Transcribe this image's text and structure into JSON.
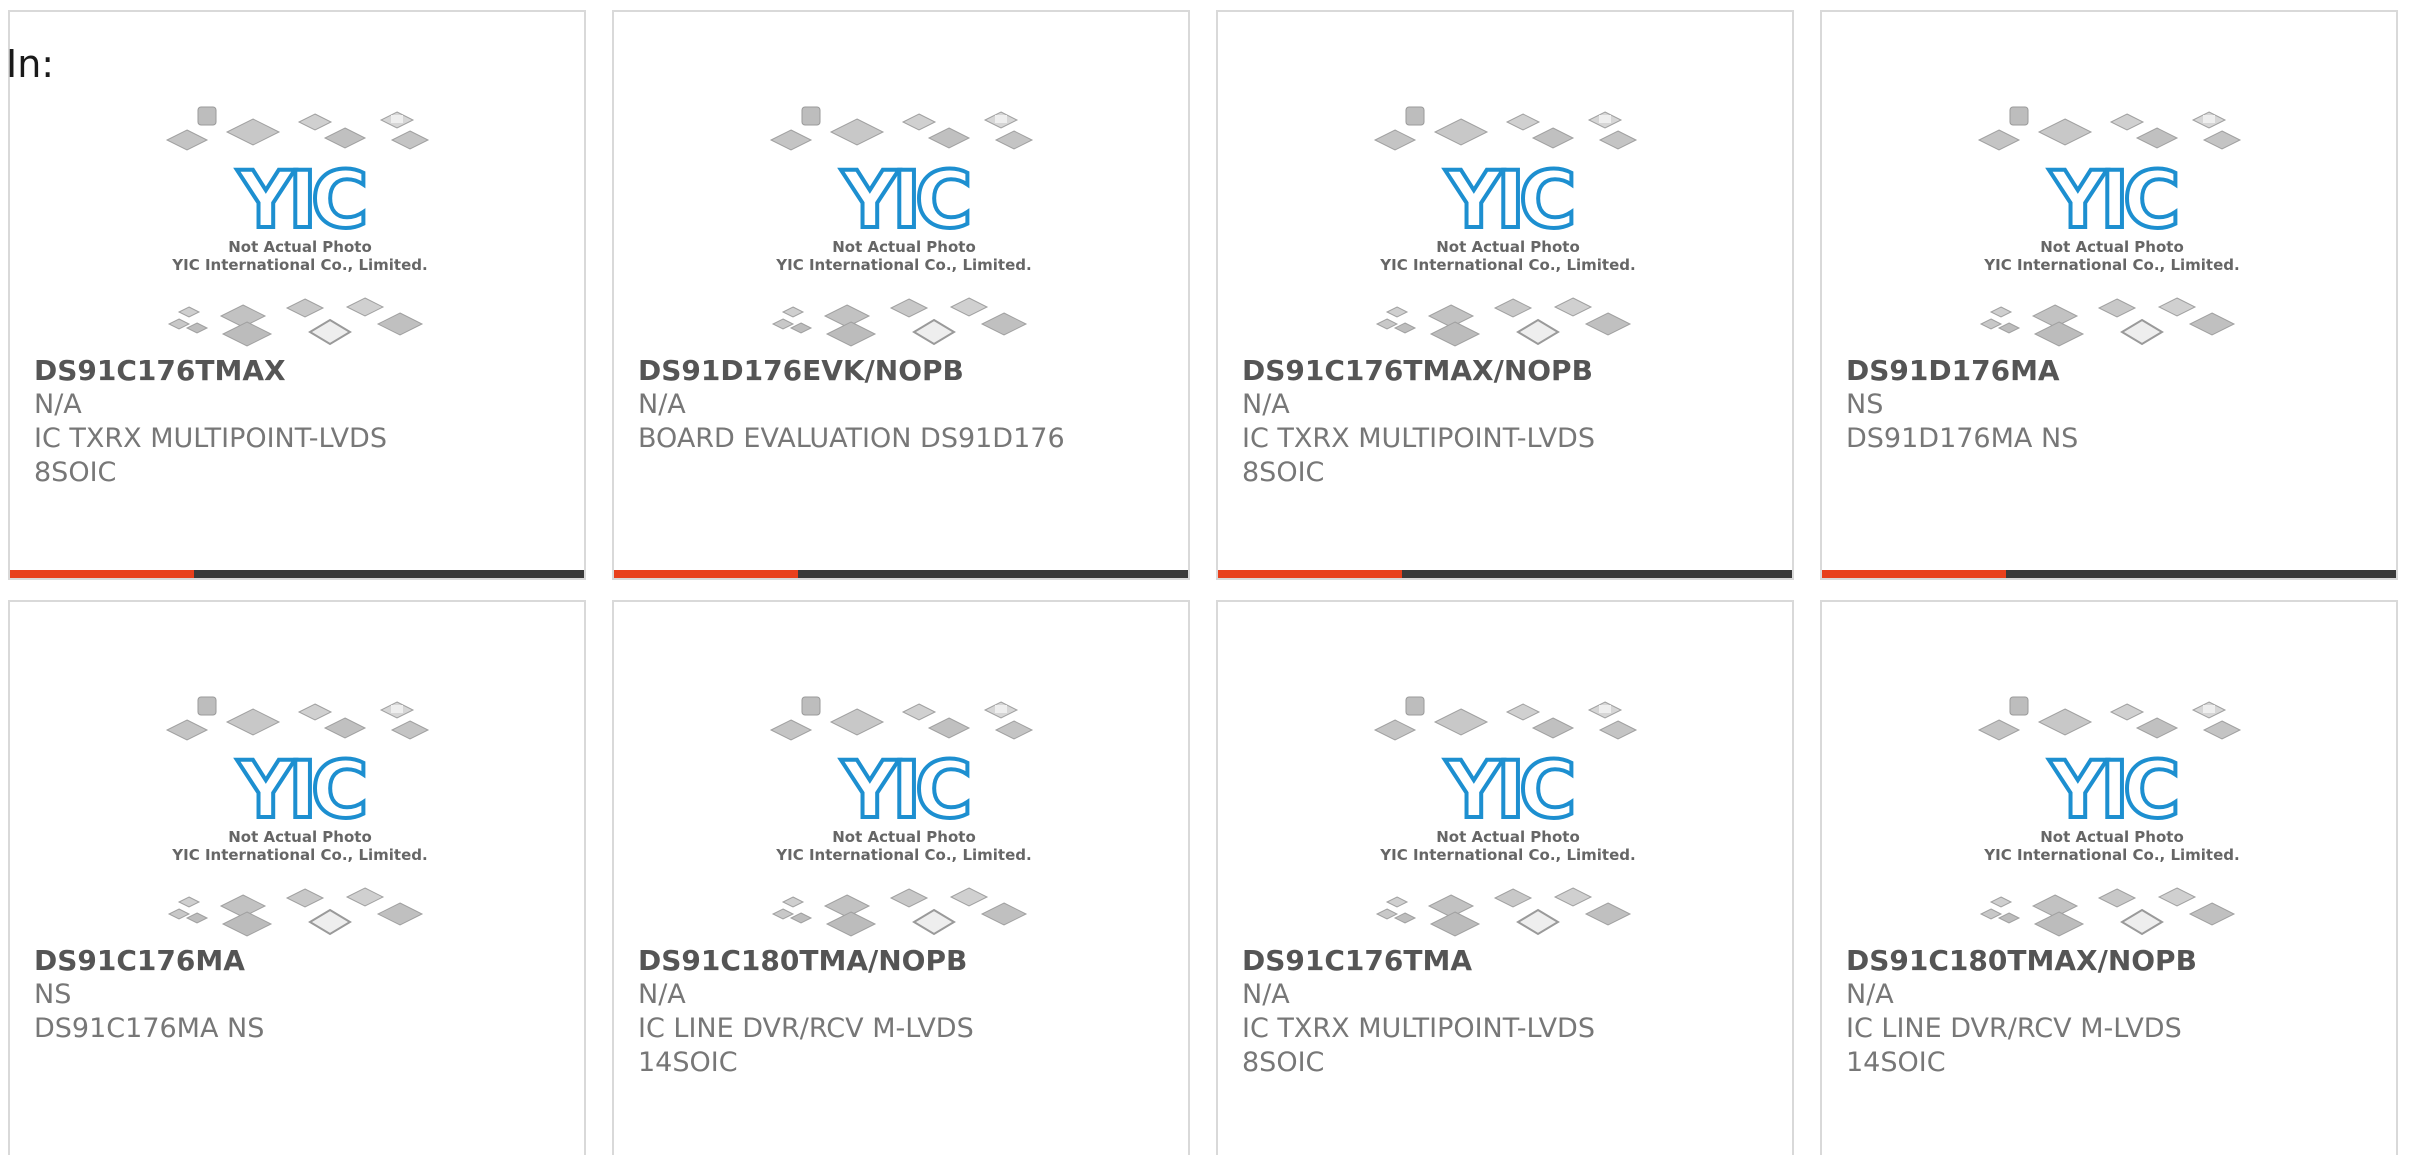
{
  "header": {
    "label": "In:"
  },
  "colors": {
    "accent": "#e8401c",
    "bar_track": "#3a3a3a",
    "logo_blue": "#1d8fd0"
  },
  "placeholder": {
    "line1": "Not Actual Photo",
    "line2": "YIC International Co., Limited.",
    "logo_text": "YIC"
  },
  "products": [
    {
      "pn": "DS91C176TMAX",
      "mfr": "N/A",
      "desc": "IC TXRX MULTIPOINT-LVDS",
      "desc2": "8SOIC",
      "progress": 0.32
    },
    {
      "pn": "DS91D176EVK/NOPB",
      "mfr": "N/A",
      "desc": "BOARD EVALUATION DS91D176",
      "desc2": "",
      "progress": 0.32
    },
    {
      "pn": "DS91C176TMAX/NOPB",
      "mfr": "N/A",
      "desc": "IC TXRX MULTIPOINT-LVDS",
      "desc2": "8SOIC",
      "progress": 0.32
    },
    {
      "pn": "DS91D176MA",
      "mfr": "NS",
      "desc": "DS91D176MA NS",
      "desc2": "",
      "progress": 0.32
    },
    {
      "pn": "DS91C176MA",
      "mfr": "NS",
      "desc": "DS91C176MA NS",
      "desc2": ""
    },
    {
      "pn": "DS91C180TMA/NOPB",
      "mfr": "N/A",
      "desc": "IC LINE DVR/RCV M-LVDS",
      "desc2": "14SOIC"
    },
    {
      "pn": "DS91C176TMA",
      "mfr": "N/A",
      "desc": "IC TXRX MULTIPOINT-LVDS",
      "desc2": "8SOIC"
    },
    {
      "pn": "DS91C180TMAX/NOPB",
      "mfr": "N/A",
      "desc": "IC LINE DVR/RCV M-LVDS",
      "desc2": "14SOIC"
    }
  ]
}
